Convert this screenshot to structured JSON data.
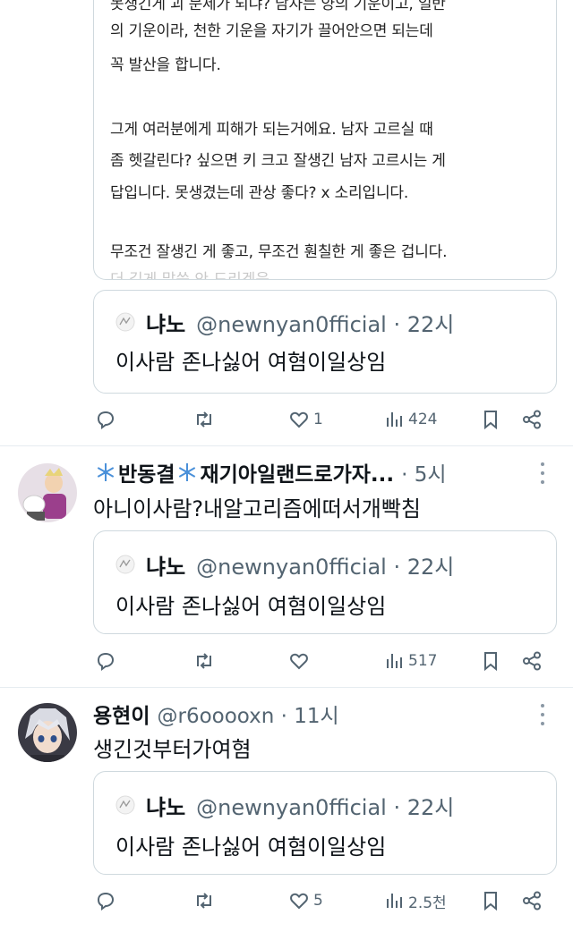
{
  "quoted_image": {
    "lines": [
      "못생긴게 괴 문제가 되냐? 남자는 양의 기운이고, 일반",
      "의 기운이라, 천한 기운을 자기가 끌어안으면 되는데",
      "꼭 발산을 합니다.",
      "그게 여러분에게 피해가 되는거에요. 남자 고르실 때",
      "좀 헷갈린다? 싶으면 키 크고 잘생긴 남자 고르시는 게",
      "답입니다. 못생겼는데 관상 좋다? x 소리입니다.",
      "무조건 잘생긴 게 좋고, 무조건 훤칠한 게 좋은 겁니다."
    ],
    "faded_line": "더 길게 말씀 안 드리겠음"
  },
  "quote": {
    "name": "냐노",
    "handle_time": "@newnyan0fficial · 22시",
    "text": "이사람 존나싫어 여혐이일상임"
  },
  "tweets": [
    {
      "actions": {
        "reply": "",
        "retweet": "",
        "like": "1",
        "views": "424"
      }
    },
    {
      "name": "반동결",
      "name_suffix": "재기아일랜드로가자...",
      "handle_time": "· 5시",
      "text": "아니이사람?내알고리즘에떠서개빡침",
      "actions": {
        "reply": "",
        "retweet": "",
        "like": "",
        "views": "517"
      }
    },
    {
      "name": "용현이",
      "handle_time": "@r6ooooxn · 11시",
      "text": "생긴것부터가여혐",
      "actions": {
        "reply": "",
        "retweet": "",
        "like": "5",
        "views": "2.5천"
      }
    }
  ],
  "icons": [
    "reply-icon",
    "retweet-icon",
    "like-icon",
    "views-icon",
    "bookmark-icon",
    "share-icon",
    "more-icon",
    "snowflake-icon"
  ],
  "colors": {
    "text": "#0f1419",
    "secondary": "#536471",
    "border": "#cfd9de",
    "snowflake": "#4a90d9"
  }
}
